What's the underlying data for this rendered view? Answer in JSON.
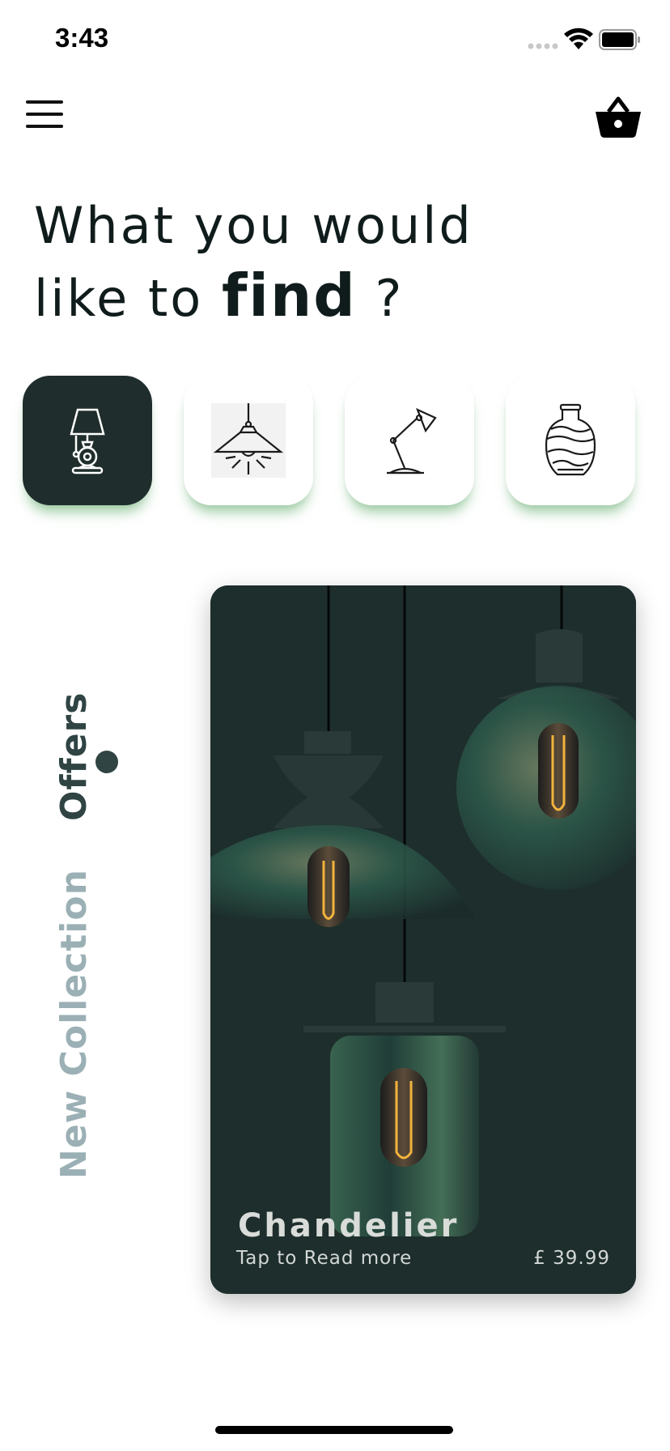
{
  "status_bar": {
    "time": "3:43"
  },
  "header": {
    "menu_icon": "hamburger-menu-icon",
    "cart_icon": "basket-icon"
  },
  "headline": {
    "line1": "What you would",
    "line2_prefix": "like to ",
    "line2_bold": "find",
    "line2_suffix": " ?"
  },
  "categories": [
    {
      "icon": "table-lamp-icon",
      "active": true
    },
    {
      "icon": "pendant-lamp-icon",
      "active": false
    },
    {
      "icon": "desk-lamp-icon",
      "active": false
    },
    {
      "icon": "vase-icon",
      "active": false
    }
  ],
  "side_tabs": [
    {
      "label": "Offers",
      "active": true
    },
    {
      "label": "New Collection",
      "active": false
    }
  ],
  "product_card": {
    "title": "Chandelier",
    "subtitle": "Tap to Read more",
    "price": "£ 39.99"
  },
  "colors": {
    "accent_dark": "#1f2e2c",
    "accent_glow": "#48a056",
    "inactive_tab": "#9bb0b5",
    "card_bg": "#1d2e2c"
  }
}
